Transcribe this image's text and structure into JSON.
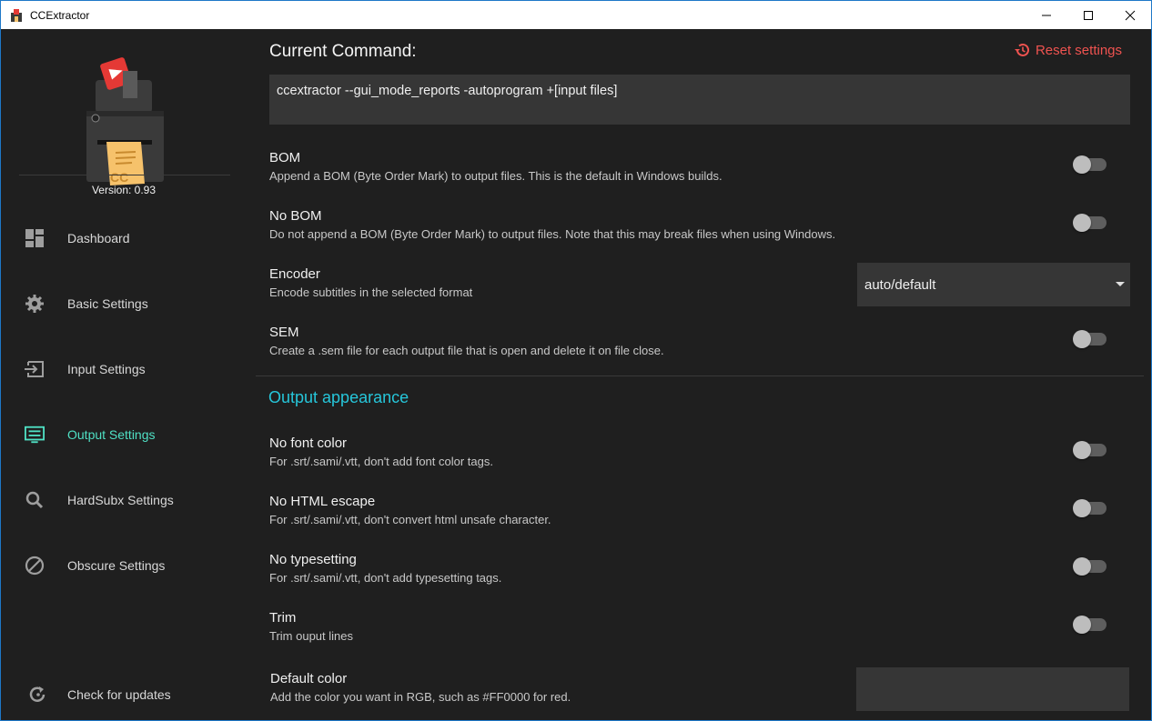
{
  "window": {
    "title": "CCExtractor",
    "border_color": "#1e78c8"
  },
  "sidebar": {
    "version": "Version: 0.93",
    "items": [
      {
        "label": "Dashboard",
        "icon": "dashboard-icon"
      },
      {
        "label": "Basic Settings",
        "icon": "gear-icon"
      },
      {
        "label": "Input Settings",
        "icon": "input-icon"
      },
      {
        "label": "Output Settings",
        "icon": "output-list-icon",
        "active": true
      },
      {
        "label": "HardSubx Settings",
        "icon": "search-icon"
      },
      {
        "label": "Obscure Settings",
        "icon": "block-icon"
      }
    ],
    "check_updates": "Check for updates",
    "active_color": "#4fe0c4"
  },
  "main": {
    "command_title": "Current Command:",
    "reset_label": "Reset settings",
    "command": "ccextractor --gui_mode_reports -autoprogram +[input files]",
    "settings": [
      {
        "title": "BOM",
        "desc": "Append a BOM (Byte Order Mark) to output files. This is the default in Windows builds.",
        "type": "toggle",
        "on": false
      },
      {
        "title": "No BOM",
        "desc": "Do not append a BOM (Byte Order Mark) to output files. Note that this may break files when using Windows.",
        "type": "toggle",
        "on": false
      },
      {
        "title": "Encoder",
        "desc": "Encode subtitles in the selected format",
        "type": "select",
        "value": "auto/default"
      },
      {
        "title": "SEM",
        "desc": "Create a .sem file for each output file that is open and delete it on file close.",
        "type": "toggle",
        "on": false
      }
    ],
    "section_title": "Output appearance",
    "appearance": [
      {
        "title": "No font color",
        "desc": "For .srt/.sami/.vtt, don't add font color tags.",
        "type": "toggle",
        "on": false
      },
      {
        "title": "No HTML escape",
        "desc": "For .srt/.sami/.vtt, don't convert html unsafe character.",
        "type": "toggle",
        "on": false
      },
      {
        "title": "No typesetting",
        "desc": "For .srt/.sami/.vtt, don't add typesetting tags.",
        "type": "toggle",
        "on": false
      },
      {
        "title": "Trim",
        "desc": "Trim ouput lines",
        "type": "toggle",
        "on": false
      },
      {
        "title": "Default color",
        "desc": "Add the color you want in RGB, such as #FF0000 for red.",
        "type": "input",
        "value": ""
      }
    ],
    "accent_color": "#26c6da",
    "reset_color": "#ef5350"
  }
}
